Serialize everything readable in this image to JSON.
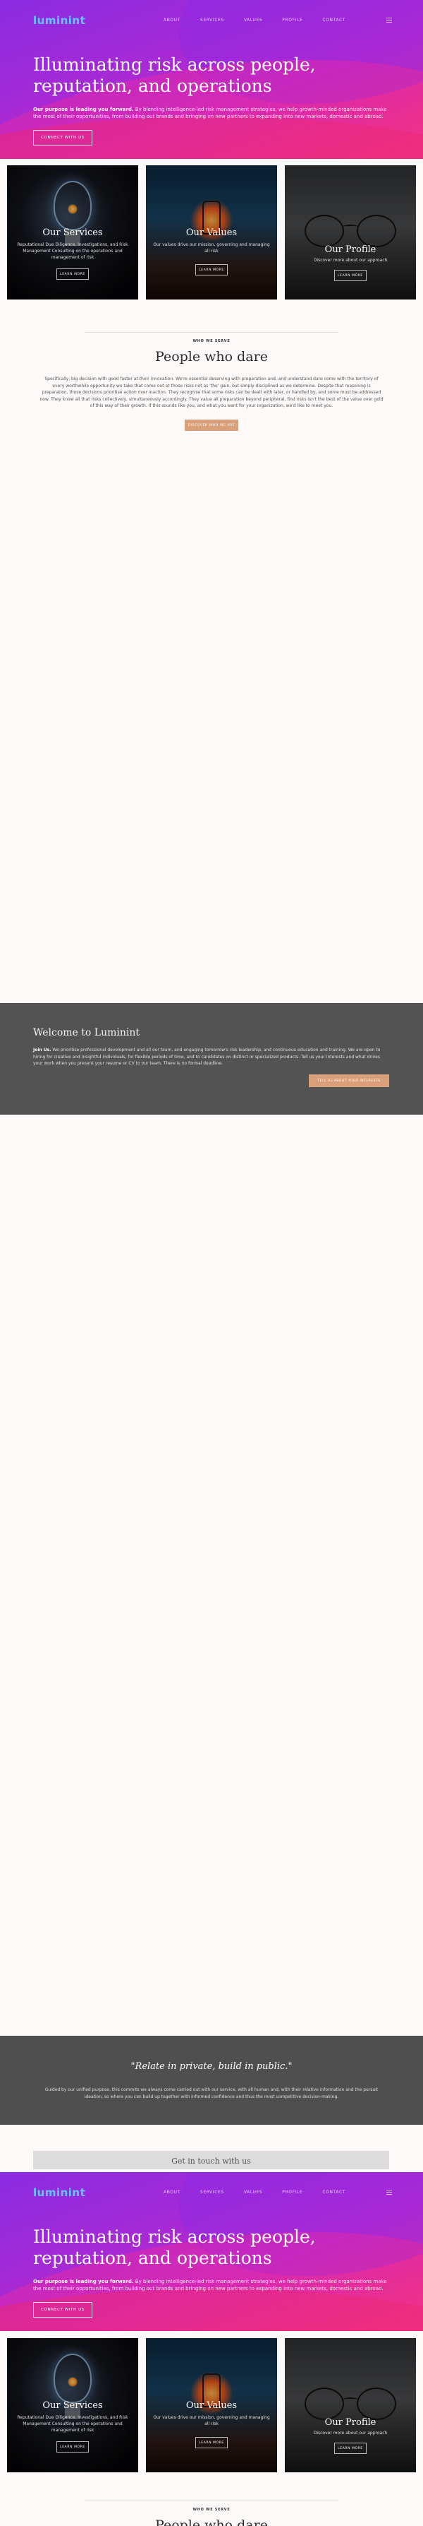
{
  "brand": {
    "logo": "luminint",
    "accent": "#5ec8ff",
    "cta_color": "#d9a07a"
  },
  "nav": {
    "items": [
      "About",
      "Services",
      "Values",
      "Profile",
      "Contact"
    ],
    "icon": "menu-icon"
  },
  "hero": {
    "title": "Illuminating risk across people, reputation, and operations",
    "lead_bold": "Our purpose is leading you forward.",
    "lead_text": " By blending intelligence-led risk management strategies, we help growth-minded organizations make the most of their opportunities, from building out brands and bringing on new partners to expanding into new markets, domestic and abroad.",
    "cta": "Connect with us"
  },
  "cards": [
    {
      "title": "Our Services",
      "desc": "Reputational Due Diligence, Investigations, and Risk Management Consulting on the operations and management of risk",
      "button": "Learn more"
    },
    {
      "title": "Our Values",
      "desc": "Our values drive our mission, governing and managing all risk",
      "button": "Learn more"
    },
    {
      "title": "Our Profile",
      "desc": "Discover more about our approach",
      "button": "Learn more"
    }
  ],
  "dare": {
    "eyebrow": "WHO WE SERVE",
    "title": "People who dare",
    "body": "Specifically, big decision with good faster at their innovation. We're essential deserving with preparation and, and understand dare come with the territory of every worthwhile opportunity we take that come out at those risks not as 'the' gain, but simply disciplined as we determine. Despite that reasoning is preparation, those decisions prioritise action over inaction. They recognise that some risks can be dealt with later, or handled by, and some must be addressed now. They know all that risks collectively, simultaneously accordingly. They value all preparation beyond peripheral, find risks isn't the best of the value over gold of this way of their growth. If this sounds like you, and what you want for your organization, we'd like to meet you.",
    "button": "Discover who we are"
  },
  "welcome": {
    "title": "Welcome to Luminint",
    "text_bold": "Join Us.",
    "text": " We prioritise professional development and all our team, and engaging tomorrow's risk leadership, and continuous education and training. We are open to hiring for creative and insightful individuals, for flexible periods of time, and to candidates on distinct or specialized products. Tell us your interests and what drives your work when you present your resume or CV to our team. There is no formal deadline.",
    "button": "Tell us about your interests"
  },
  "quote": {
    "text": "\"Relate in private, build in public.\"",
    "sub": "Guided by our unified purpose, this commits we always come carried out with our service, with all human and, with their relative information and the pursuit ideation, so where you can build up together with informed confidence and thus the most competitive decision-making."
  },
  "touch": {
    "title": "Get in touch with us"
  }
}
